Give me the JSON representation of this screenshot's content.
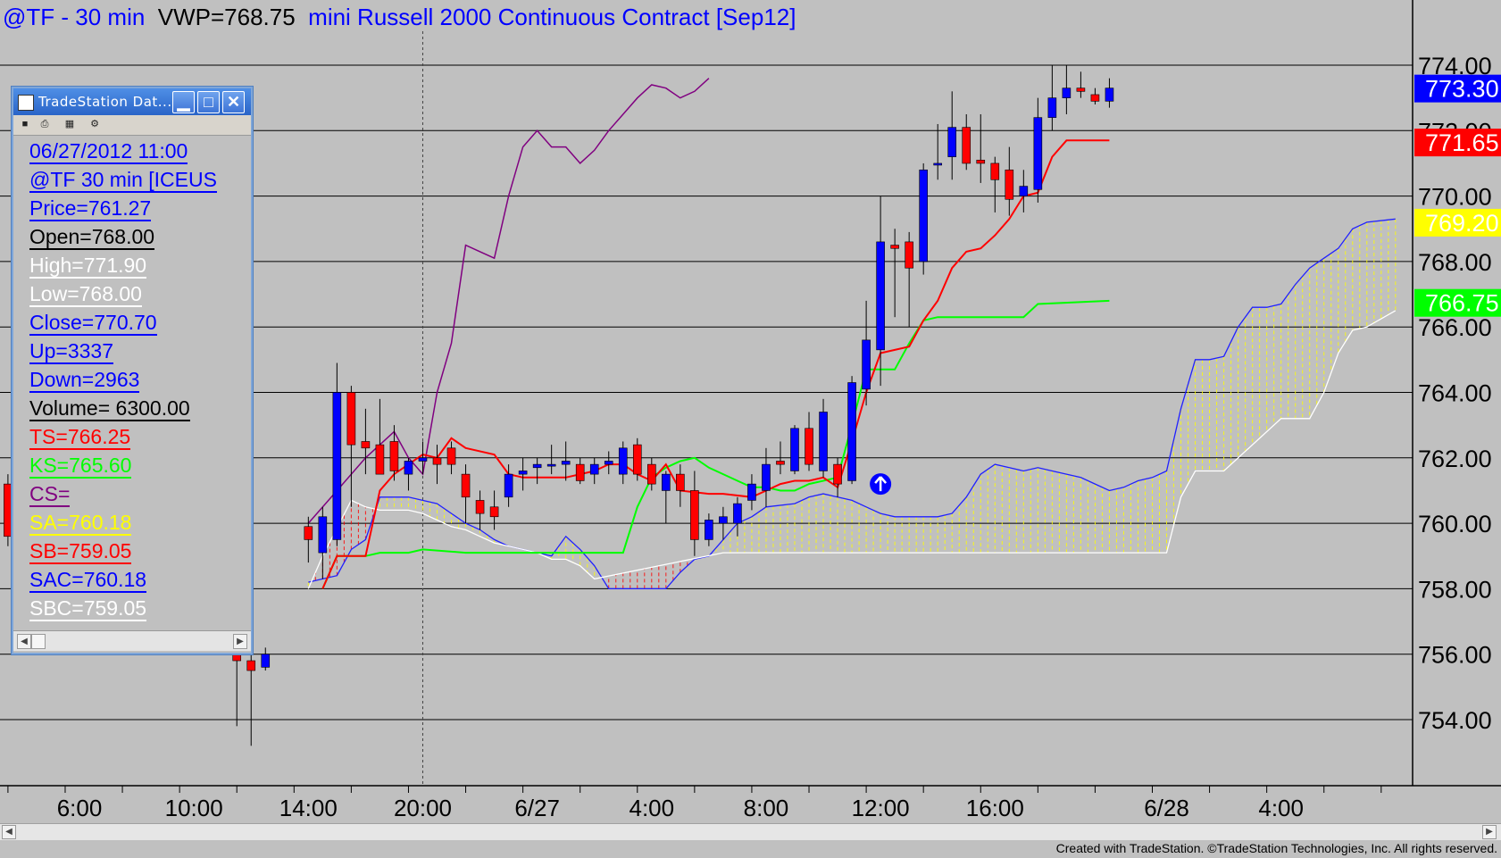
{
  "title": {
    "symbol": "@TF - 30 min",
    "vwp": "VWP=768.75",
    "contract": "mini Russell 2000 Continuous Contract [Sep12]"
  },
  "credit": "Created with TradeStation. ©TradeStation Technologies, Inc. All rights reserved.",
  "data_window": {
    "title": "TradeStation Dat...",
    "rows": [
      {
        "text": "06/27/2012 11:00",
        "color": "#0000ff"
      },
      {
        "text": "@TF 30 min [ICEUS",
        "color": "#0000ff"
      },
      {
        "text": "Price=761.27",
        "color": "#0000ff"
      },
      {
        "text": "Open=768.00",
        "color": "#000000"
      },
      {
        "text": "High=771.90",
        "color": "#ffffff"
      },
      {
        "text": "Low=768.00",
        "color": "#ffffff"
      },
      {
        "text": "Close=770.70",
        "color": "#0000ff"
      },
      {
        "text": "Up=3337",
        "color": "#0000ff"
      },
      {
        "text": "Down=2963",
        "color": "#0000ff"
      },
      {
        "text": "Volume= 6300.00",
        "color": "#000000"
      },
      {
        "text": "TS=766.25",
        "color": "#ff0000"
      },
      {
        "text": "KS=765.60",
        "color": "#00ff00"
      },
      {
        "text": "CS=",
        "color": "#800080"
      },
      {
        "text": "SA=760.18",
        "color": "#ffff00"
      },
      {
        "text": "SB=759.05",
        "color": "#ff0000"
      },
      {
        "text": "SAC=760.18",
        "color": "#0000ff"
      },
      {
        "text": "SBC=759.05",
        "color": "#ffffff"
      }
    ]
  },
  "chart_data": {
    "type": "candlestick",
    "title": "@TF - 30 min VWP=768.75 mini Russell 2000 Continuous Contract [Sep12]",
    "ylim": [
      752.0,
      776.0
    ],
    "y_ticks": [
      754.0,
      756.0,
      758.0,
      760.0,
      762.0,
      764.0,
      766.0,
      768.0,
      770.0,
      772.0,
      774.0
    ],
    "x_ticks": [
      {
        "label": "6:00",
        "i": 1
      },
      {
        "label": "10:00",
        "i": 9
      },
      {
        "label": "14:00",
        "i": 17
      },
      {
        "label": "20:00",
        "i": 25
      },
      {
        "label": "6/27",
        "i": 33
      },
      {
        "label": "4:00",
        "i": 41
      },
      {
        "label": "8:00",
        "i": 49
      },
      {
        "label": "12:00",
        "i": 57
      },
      {
        "label": "16:00",
        "i": 65
      },
      {
        "label": "6/28",
        "i": 77
      },
      {
        "label": "4:00",
        "i": 85
      }
    ],
    "price_labels": [
      {
        "value": 773.3,
        "text": "773.30",
        "bg": "#0000ff",
        "fg": "#ffffff"
      },
      {
        "value": 771.65,
        "text": "771.65",
        "bg": "#ff0000",
        "fg": "#ffffff"
      },
      {
        "value": 769.2,
        "text": "769.20",
        "bg": "#ffff00",
        "fg": "#ffffff"
      },
      {
        "value": 766.75,
        "text": "766.75",
        "bg": "#00ff00",
        "fg": "#ffffff"
      }
    ],
    "candles": [
      {
        "i": -4,
        "o": 761.2,
        "h": 761.5,
        "l": 759.3,
        "c": 759.6
      },
      {
        "i": 12,
        "o": 756.0,
        "h": 756.3,
        "l": 753.8,
        "c": 755.8
      },
      {
        "i": 13,
        "o": 755.8,
        "h": 756.1,
        "l": 753.2,
        "c": 755.5
      },
      {
        "i": 14,
        "o": 755.6,
        "h": 756.2,
        "l": 755.5,
        "c": 756.0
      },
      {
        "i": 17,
        "o": 759.9,
        "h": 760.2,
        "l": 758.8,
        "c": 759.5
      },
      {
        "i": 18,
        "o": 759.1,
        "h": 760.5,
        "l": 758.3,
        "c": 760.2
      },
      {
        "i": 19,
        "o": 759.5,
        "h": 764.9,
        "l": 759.3,
        "c": 764.0
      },
      {
        "i": 20,
        "o": 764.0,
        "h": 764.2,
        "l": 760.5,
        "c": 762.4
      },
      {
        "i": 21,
        "o": 762.5,
        "h": 763.5,
        "l": 761.5,
        "c": 762.3
      },
      {
        "i": 22,
        "o": 762.4,
        "h": 763.8,
        "l": 761.8,
        "c": 761.5
      },
      {
        "i": 23,
        "o": 762.5,
        "h": 763.0,
        "l": 761.3,
        "c": 761.6
      },
      {
        "i": 24,
        "o": 761.5,
        "h": 762.0,
        "l": 761.0,
        "c": 761.9
      },
      {
        "i": 25,
        "o": 761.9,
        "h": 762.5,
        "l": 761.5,
        "c": 762.0
      },
      {
        "i": 26,
        "o": 762.0,
        "h": 762.4,
        "l": 761.2,
        "c": 761.8
      },
      {
        "i": 27,
        "o": 762.3,
        "h": 762.5,
        "l": 761.5,
        "c": 761.8
      },
      {
        "i": 28,
        "o": 761.5,
        "h": 761.8,
        "l": 760.0,
        "c": 760.8
      },
      {
        "i": 29,
        "o": 760.7,
        "h": 761.0,
        "l": 759.8,
        "c": 760.3
      },
      {
        "i": 30,
        "o": 760.5,
        "h": 761.0,
        "l": 759.8,
        "c": 760.2
      },
      {
        "i": 31,
        "o": 760.8,
        "h": 761.8,
        "l": 760.5,
        "c": 761.5
      },
      {
        "i": 32,
        "o": 761.5,
        "h": 762.0,
        "l": 761.0,
        "c": 761.6
      },
      {
        "i": 33,
        "o": 761.7,
        "h": 762.0,
        "l": 761.2,
        "c": 761.8
      },
      {
        "i": 34,
        "o": 761.8,
        "h": 762.4,
        "l": 761.5,
        "c": 761.8
      },
      {
        "i": 35,
        "o": 761.8,
        "h": 762.5,
        "l": 761.3,
        "c": 761.9
      },
      {
        "i": 36,
        "o": 761.8,
        "h": 762.0,
        "l": 761.2,
        "c": 761.3
      },
      {
        "i": 37,
        "o": 761.5,
        "h": 762.0,
        "l": 761.2,
        "c": 761.8
      },
      {
        "i": 38,
        "o": 761.8,
        "h": 762.2,
        "l": 761.5,
        "c": 761.9
      },
      {
        "i": 39,
        "o": 761.5,
        "h": 762.5,
        "l": 761.2,
        "c": 762.3
      },
      {
        "i": 40,
        "o": 762.4,
        "h": 762.6,
        "l": 761.3,
        "c": 761.5
      },
      {
        "i": 41,
        "o": 761.8,
        "h": 762.0,
        "l": 761.0,
        "c": 761.2
      },
      {
        "i": 42,
        "o": 761.0,
        "h": 761.6,
        "l": 760.0,
        "c": 761.5
      },
      {
        "i": 43,
        "o": 761.5,
        "h": 761.8,
        "l": 760.5,
        "c": 761.0
      },
      {
        "i": 44,
        "o": 761.0,
        "h": 761.6,
        "l": 759.0,
        "c": 759.5
      },
      {
        "i": 45,
        "o": 759.5,
        "h": 760.3,
        "l": 759.3,
        "c": 760.1
      },
      {
        "i": 46,
        "o": 760.0,
        "h": 760.5,
        "l": 759.5,
        "c": 760.2
      },
      {
        "i": 47,
        "o": 760.0,
        "h": 760.8,
        "l": 759.6,
        "c": 760.6
      },
      {
        "i": 48,
        "o": 760.7,
        "h": 761.5,
        "l": 760.4,
        "c": 761.2
      },
      {
        "i": 49,
        "o": 761.0,
        "h": 762.3,
        "l": 760.5,
        "c": 761.8
      },
      {
        "i": 50,
        "o": 761.9,
        "h": 762.5,
        "l": 761.5,
        "c": 761.8
      },
      {
        "i": 51,
        "o": 761.6,
        "h": 763.0,
        "l": 761.5,
        "c": 762.9
      },
      {
        "i": 52,
        "o": 762.9,
        "h": 763.4,
        "l": 761.6,
        "c": 761.8
      },
      {
        "i": 53,
        "o": 761.6,
        "h": 763.8,
        "l": 761.4,
        "c": 763.4
      },
      {
        "i": 54,
        "o": 761.8,
        "h": 762.0,
        "l": 760.8,
        "c": 761.2
      },
      {
        "i": 55,
        "o": 761.3,
        "h": 764.5,
        "l": 761.2,
        "c": 764.3
      },
      {
        "i": 56,
        "o": 764.1,
        "h": 766.8,
        "l": 763.6,
        "c": 765.6
      },
      {
        "i": 57,
        "o": 765.3,
        "h": 770.0,
        "l": 764.2,
        "c": 768.6
      },
      {
        "i": 58,
        "o": 768.5,
        "h": 769.0,
        "l": 766.3,
        "c": 768.4
      },
      {
        "i": 59,
        "o": 768.6,
        "h": 768.9,
        "l": 766.0,
        "c": 767.8
      },
      {
        "i": 60,
        "o": 768.0,
        "h": 771.0,
        "l": 767.6,
        "c": 770.8
      },
      {
        "i": 61,
        "o": 771.0,
        "h": 772.2,
        "l": 770.5,
        "c": 771.0
      },
      {
        "i": 62,
        "o": 771.2,
        "h": 773.2,
        "l": 770.5,
        "c": 772.1
      },
      {
        "i": 63,
        "o": 772.1,
        "h": 772.5,
        "l": 770.8,
        "c": 771.0
      },
      {
        "i": 64,
        "o": 771.1,
        "h": 772.5,
        "l": 770.4,
        "c": 771.0
      },
      {
        "i": 65,
        "o": 771.0,
        "h": 771.2,
        "l": 769.5,
        "c": 770.5
      },
      {
        "i": 66,
        "o": 770.8,
        "h": 771.5,
        "l": 769.4,
        "c": 769.9
      },
      {
        "i": 67,
        "o": 770.0,
        "h": 770.8,
        "l": 769.5,
        "c": 770.3
      },
      {
        "i": 68,
        "o": 770.2,
        "h": 773.0,
        "l": 769.8,
        "c": 772.4
      },
      {
        "i": 69,
        "o": 772.4,
        "h": 774.0,
        "l": 772.0,
        "c": 773.0
      },
      {
        "i": 70,
        "o": 773.0,
        "h": 774.0,
        "l": 772.5,
        "c": 773.3
      },
      {
        "i": 71,
        "o": 773.3,
        "h": 773.8,
        "l": 773.0,
        "c": 773.2
      },
      {
        "i": 72,
        "o": 773.1,
        "h": 773.3,
        "l": 772.8,
        "c": 772.9
      },
      {
        "i": 73,
        "o": 772.9,
        "h": 773.6,
        "l": 772.7,
        "c": 773.3
      }
    ],
    "tenkan": [
      [
        18,
        758
      ],
      [
        19,
        759
      ],
      [
        21,
        759
      ],
      [
        22,
        761
      ],
      [
        23,
        761.5
      ],
      [
        24,
        761.8
      ],
      [
        25,
        762.1
      ],
      [
        26,
        762
      ],
      [
        27,
        762.6
      ],
      [
        28,
        762.3
      ],
      [
        30,
        762.1
      ],
      [
        31,
        761.5
      ],
      [
        32,
        761.4
      ],
      [
        35,
        761.4
      ],
      [
        37,
        761.6
      ],
      [
        38,
        761.8
      ],
      [
        39,
        761.8
      ],
      [
        40,
        761.5
      ],
      [
        41,
        761.3
      ],
      [
        42,
        761.8
      ],
      [
        43,
        761.0
      ],
      [
        45,
        760.9
      ],
      [
        46,
        760.9
      ],
      [
        48,
        760.8
      ],
      [
        49,
        761.0
      ],
      [
        50,
        761.2
      ],
      [
        51,
        761.3
      ],
      [
        52,
        761.3
      ],
      [
        53,
        761.4
      ],
      [
        54,
        761.1
      ],
      [
        55,
        762.5
      ],
      [
        56,
        764.0
      ],
      [
        57,
        765.2
      ],
      [
        58,
        765.3
      ],
      [
        59,
        765.4
      ],
      [
        60,
        766.2
      ],
      [
        61,
        766.8
      ],
      [
        62,
        767.8
      ],
      [
        63,
        768.3
      ],
      [
        64,
        768.4
      ],
      [
        65,
        768.8
      ],
      [
        66,
        769.3
      ],
      [
        67,
        770.0
      ],
      [
        68,
        770.1
      ],
      [
        69,
        771.2
      ],
      [
        70,
        771.7
      ],
      [
        73,
        771.7
      ]
    ],
    "kijun": [
      [
        18,
        758
      ],
      [
        19,
        759
      ],
      [
        21,
        759
      ],
      [
        22,
        759.1
      ],
      [
        24,
        759.1
      ],
      [
        25,
        759.2
      ],
      [
        28,
        759.1
      ],
      [
        39,
        759.1
      ],
      [
        40,
        760.5
      ],
      [
        41,
        761.4
      ],
      [
        42,
        761.7
      ],
      [
        43,
        761.9
      ],
      [
        44,
        762.0
      ],
      [
        45,
        761.7
      ],
      [
        46,
        761.5
      ],
      [
        47,
        761.3
      ],
      [
        48,
        761.1
      ],
      [
        49,
        761.1
      ],
      [
        50,
        761.0
      ],
      [
        51,
        761.0
      ],
      [
        52,
        761.2
      ],
      [
        53,
        761.3
      ],
      [
        54,
        761.4
      ],
      [
        55,
        763.0
      ],
      [
        56,
        764.7
      ],
      [
        57,
        764.7
      ],
      [
        58,
        764.7
      ],
      [
        59,
        765.5
      ],
      [
        60,
        766.2
      ],
      [
        61,
        766.3
      ],
      [
        62,
        766.3
      ],
      [
        67,
        766.3
      ],
      [
        68,
        766.7
      ],
      [
        73,
        766.8
      ]
    ],
    "chikou": [
      [
        17,
        760.0
      ],
      [
        19,
        761.0
      ],
      [
        21,
        762.0
      ],
      [
        23,
        762.8
      ],
      [
        24,
        762.0
      ],
      [
        25,
        761.5
      ],
      [
        26,
        764.0
      ],
      [
        27,
        765.5
      ],
      [
        28,
        768.5
      ],
      [
        29,
        768.3
      ],
      [
        30,
        768.1
      ],
      [
        31,
        770.0
      ],
      [
        32,
        771.5
      ],
      [
        33,
        772.0
      ],
      [
        34,
        771.5
      ],
      [
        35,
        771.5
      ],
      [
        36,
        771.0
      ],
      [
        37,
        771.4
      ],
      [
        38,
        772.0
      ],
      [
        39,
        772.5
      ],
      [
        40,
        773.0
      ],
      [
        41,
        773.4
      ],
      [
        42,
        773.3
      ],
      [
        43,
        773.0
      ],
      [
        44,
        773.2
      ],
      [
        45,
        773.6
      ]
    ],
    "senkou_a": [
      [
        17,
        758.2
      ],
      [
        18,
        758.3
      ],
      [
        19,
        758.4
      ],
      [
        20,
        759.2
      ],
      [
        21,
        759.5
      ],
      [
        22,
        760.8
      ],
      [
        24,
        760.8
      ],
      [
        26,
        760.6
      ],
      [
        27,
        760.3
      ],
      [
        28,
        760.0
      ],
      [
        29,
        759.8
      ],
      [
        30,
        759.5
      ],
      [
        31,
        759.3
      ],
      [
        32,
        759.2
      ],
      [
        33,
        759.1
      ],
      [
        34,
        759.0
      ],
      [
        35,
        759.6
      ],
      [
        36,
        759.2
      ],
      [
        37,
        758.7
      ],
      [
        38,
        758.0
      ],
      [
        39,
        758.0
      ],
      [
        42,
        758.0
      ],
      [
        43,
        758.5
      ],
      [
        44,
        758.9
      ],
      [
        45,
        759.0
      ],
      [
        46,
        759.5
      ],
      [
        47,
        760.0
      ],
      [
        48,
        760.2
      ],
      [
        49,
        760.5
      ],
      [
        51,
        760.6
      ],
      [
        52,
        760.8
      ],
      [
        53,
        760.9
      ],
      [
        54,
        760.8
      ],
      [
        55,
        760.7
      ],
      [
        56,
        760.5
      ],
      [
        57,
        760.3
      ],
      [
        58,
        760.2
      ],
      [
        61,
        760.2
      ],
      [
        62,
        760.3
      ],
      [
        63,
        760.8
      ],
      [
        64,
        761.5
      ],
      [
        65,
        761.8
      ],
      [
        66,
        761.7
      ],
      [
        67,
        761.6
      ],
      [
        68,
        761.7
      ],
      [
        69,
        761.6
      ],
      [
        70,
        761.5
      ],
      [
        71,
        761.4
      ],
      [
        72,
        761.2
      ],
      [
        73,
        761.0
      ],
      [
        74,
        761.1
      ],
      [
        75,
        761.3
      ],
      [
        76,
        761.4
      ],
      [
        77,
        761.6
      ],
      [
        78,
        763.5
      ],
      [
        79,
        765.0
      ],
      [
        80,
        765.0
      ],
      [
        81,
        765.1
      ],
      [
        82,
        766.0
      ],
      [
        83,
        766.6
      ],
      [
        84,
        766.6
      ],
      [
        85,
        766.7
      ],
      [
        86,
        767.3
      ],
      [
        87,
        767.8
      ],
      [
        88,
        768.1
      ],
      [
        89,
        768.4
      ],
      [
        90,
        769.0
      ],
      [
        91,
        769.2
      ],
      [
        93,
        769.3
      ]
    ],
    "senkou_b": [
      [
        17,
        758
      ],
      [
        18,
        759
      ],
      [
        20,
        760.7
      ],
      [
        21,
        760.5
      ],
      [
        22,
        760.4
      ],
      [
        24,
        760.4
      ],
      [
        25,
        760.3
      ],
      [
        27,
        759.9
      ],
      [
        28,
        759.8
      ],
      [
        29,
        759.6
      ],
      [
        30,
        759.4
      ],
      [
        31,
        759.3
      ],
      [
        32,
        759.2
      ],
      [
        33,
        759.1
      ],
      [
        34,
        758.9
      ],
      [
        35,
        758.9
      ],
      [
        36,
        758.7
      ],
      [
        37,
        758.3
      ],
      [
        46,
        759.1
      ],
      [
        77,
        759.1
      ],
      [
        78,
        760.8
      ],
      [
        79,
        761.6
      ],
      [
        81,
        761.6
      ],
      [
        85,
        763.2
      ],
      [
        87,
        763.2
      ],
      [
        88,
        764.0
      ],
      [
        89,
        765.2
      ],
      [
        90,
        765.9
      ],
      [
        91,
        766.0
      ],
      [
        93,
        766.5
      ]
    ],
    "cursor_x_i": 25,
    "signal_arrow": {
      "i": 57,
      "y": 761.2
    }
  }
}
